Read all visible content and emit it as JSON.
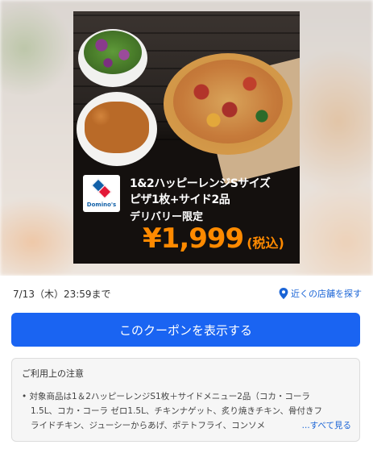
{
  "hero": {
    "brand": {
      "logo_text": "Domino's",
      "colors": {
        "blue": "#1160a8",
        "red": "#e31837"
      }
    },
    "ad": {
      "line1": "1&2ハッピーレンジSサイズ",
      "line2": "ピザ1枚+サイド2品",
      "line3": "デリバリー限定",
      "price": "¥1,999",
      "price_suffix": "(税込)",
      "price_color": "#ff8a00"
    }
  },
  "coupon": {
    "expiry": "7/13（木）23:59まで",
    "store_link": {
      "icon": "map-pin-icon",
      "label": "近くの店舗を探す"
    },
    "show_button_label": "このクーポンを表示する",
    "accent_color": "#1a64f2"
  },
  "notes": {
    "title": "ご利用上の注意",
    "lines": [
      "• 対象商品は1＆2ハッピーレンジS1枚＋サイドメニュー2品（コカ・コーラ",
      "1.5L、コカ・コーラ ゼロ1.5L、チキンナゲット、炙り焼きチキン、骨付きフ",
      "ライドチキン、ジューシーからあげ、ポテトフライ、コンソメ"
    ],
    "see_more": "...すべて見る"
  }
}
